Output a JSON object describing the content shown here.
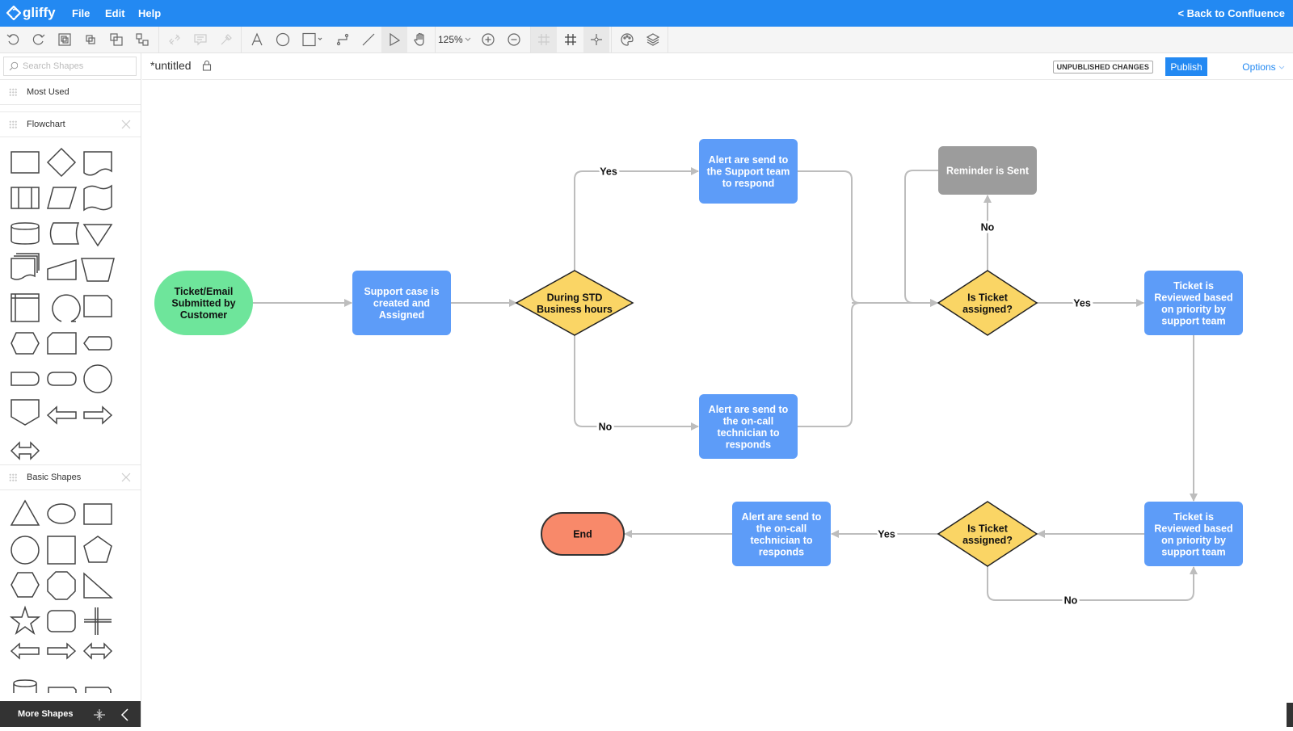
{
  "app": {
    "brand": "gliffy",
    "menus": [
      "File",
      "Edit",
      "Help"
    ],
    "back_link": "< Back to Confluence"
  },
  "toolbar": {
    "zoom_level": "125%",
    "buttons": [
      "undo-icon",
      "redo-icon",
      "group-icon",
      "bring-forward-icon",
      "send-backward-icon",
      "arrange-icon",
      "link-icon",
      "comment-icon",
      "eyedropper-icon",
      "text-tool-icon",
      "ellipse-tool-icon",
      "rectangle-tool-icon",
      "connector-tool-icon",
      "line-tool-icon",
      "pointer-tool-icon",
      "hand-tool-icon",
      "zoom-in-icon",
      "zoom-out-icon",
      "snap-grid-icon",
      "show-grid-icon",
      "snap-point-icon",
      "theme-palette-icon",
      "layers-icon"
    ]
  },
  "sidebar": {
    "search_placeholder": "Search Shapes",
    "sections": [
      {
        "title": "Most Used",
        "closable": false
      },
      {
        "title": "Flowchart",
        "closable": true
      },
      {
        "title": "Basic Shapes",
        "closable": true
      }
    ],
    "more_shapes_label": "More Shapes"
  },
  "document": {
    "title": "*untitled",
    "status_badge": "UNPUBLISHED CHANGES",
    "publish_label": "Publish",
    "options_label": "Options"
  },
  "diagram": {
    "colors": {
      "start": "#6ee59b",
      "process": "#5d9cf8",
      "decision": "#fad565",
      "reminder": "#9c9c9c",
      "end": "#f8896a",
      "connector": "#bdbdbd",
      "brand": "#2389f2"
    },
    "nodes": {
      "start": [
        "Ticket/Email",
        "Submitted by",
        "Customer"
      ],
      "support_case": [
        "Support case is",
        "created and",
        "Assigned"
      ],
      "business_hours": [
        "During STD",
        "Business hours"
      ],
      "alert_support": [
        "Alert are send to",
        "the Support team",
        "to respond"
      ],
      "alert_oncall": [
        "Alert are send to",
        "the on-call",
        "technician to",
        "responds"
      ],
      "reminder": [
        "Reminder is Sent"
      ],
      "is_assigned_1": [
        "Is Ticket",
        "assigned?"
      ],
      "review_1": [
        "Ticket is",
        "Reviewed based",
        "on priority by",
        "support team"
      ],
      "review_2": [
        "Ticket is",
        "Reviewed based",
        "on priority by",
        "support team"
      ],
      "is_assigned_2": [
        "Is Ticket",
        "assigned?"
      ],
      "alert_oncall_2": [
        "Alert are send to",
        "the on-call",
        "technician to",
        "responds"
      ],
      "end": [
        "End"
      ]
    },
    "edge_labels": {
      "hours_yes": "Yes",
      "hours_no": "No",
      "assigned1_no": "No",
      "assigned1_yes": "Yes",
      "assigned2_yes": "Yes",
      "assigned2_no": "No"
    }
  }
}
